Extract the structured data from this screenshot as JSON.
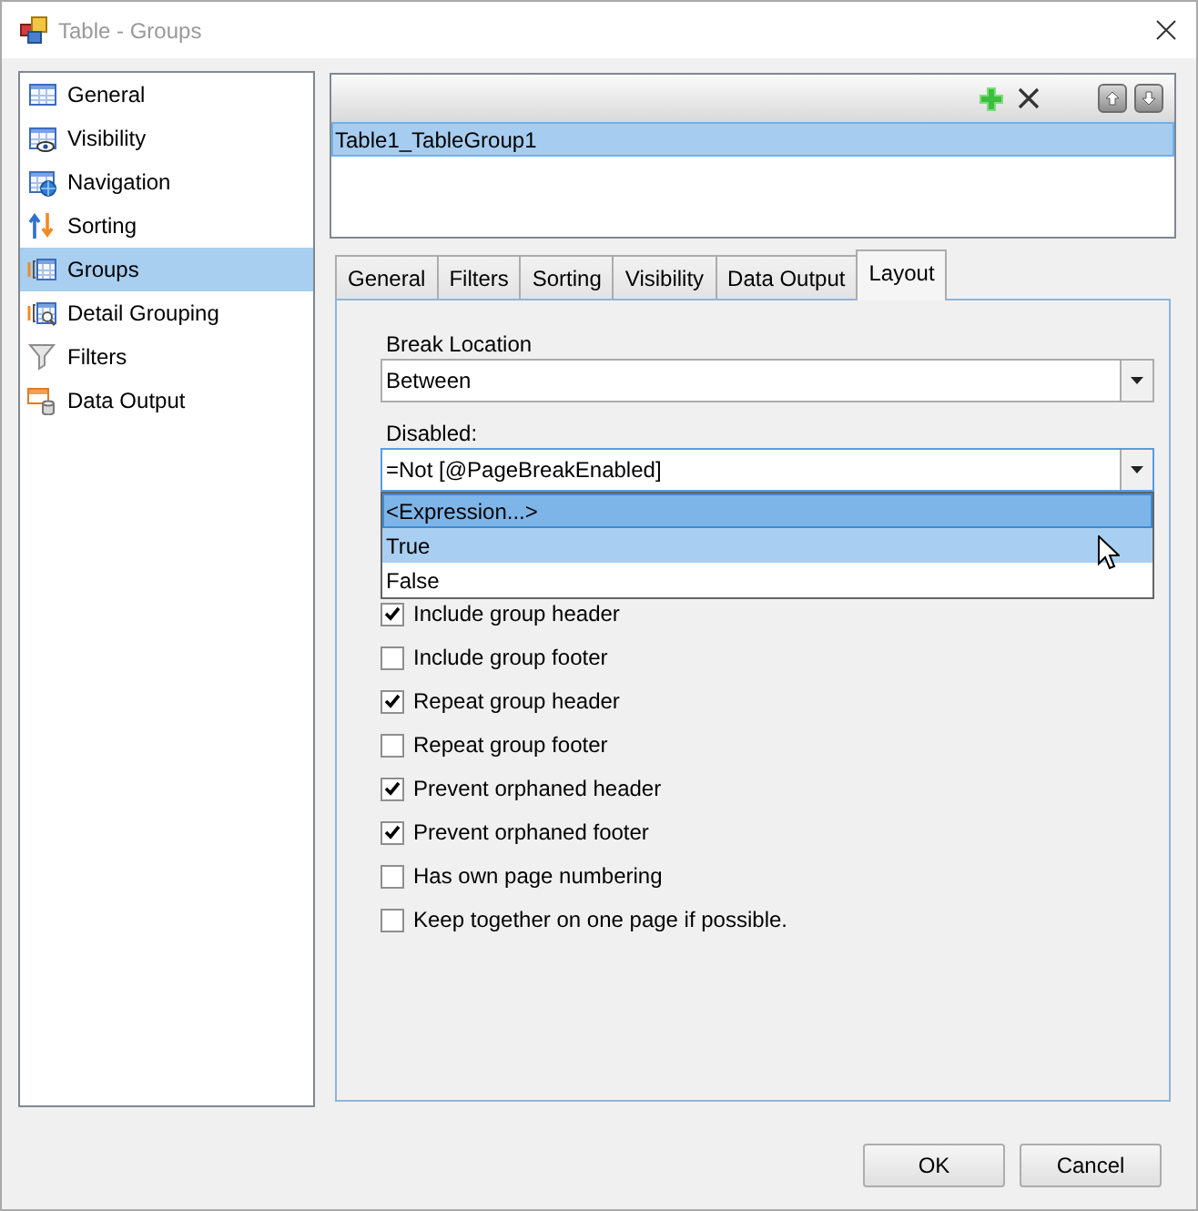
{
  "window": {
    "title": "Table - Groups"
  },
  "sidebar": {
    "items": [
      {
        "label": "General",
        "selected": false
      },
      {
        "label": "Visibility",
        "selected": false
      },
      {
        "label": "Navigation",
        "selected": false
      },
      {
        "label": "Sorting",
        "selected": false
      },
      {
        "label": "Groups",
        "selected": true
      },
      {
        "label": "Detail Grouping",
        "selected": false
      },
      {
        "label": "Filters",
        "selected": false
      },
      {
        "label": "Data Output",
        "selected": false
      }
    ]
  },
  "groups_list": {
    "rows": [
      {
        "label": "Table1_TableGroup1",
        "selected": true
      }
    ]
  },
  "tabs": [
    {
      "label": "General",
      "selected": false
    },
    {
      "label": "Filters",
      "selected": false
    },
    {
      "label": "Sorting",
      "selected": false
    },
    {
      "label": "Visibility",
      "selected": false
    },
    {
      "label": "Data Output",
      "selected": false
    },
    {
      "label": "Layout",
      "selected": true
    }
  ],
  "layout": {
    "break_location": {
      "label": "Break Location",
      "value": "Between"
    },
    "disabled": {
      "label": "Disabled:",
      "value": "=Not [@PageBreakEnabled]",
      "expanded": true,
      "options": [
        {
          "label": "<Expression...>",
          "selected": true,
          "hovered": false
        },
        {
          "label": "True",
          "selected": false,
          "hovered": true
        },
        {
          "label": "False",
          "selected": false,
          "hovered": false
        }
      ]
    },
    "checkboxes": [
      {
        "label": "Include group header",
        "checked": true
      },
      {
        "label": "Include group footer",
        "checked": false
      },
      {
        "label": "Repeat group header",
        "checked": true
      },
      {
        "label": "Repeat group footer",
        "checked": false
      },
      {
        "label": "Prevent orphaned header",
        "checked": true
      },
      {
        "label": "Prevent orphaned footer",
        "checked": true
      },
      {
        "label": "Has own page numbering",
        "checked": false
      },
      {
        "label": "Keep together on one page if possible.",
        "checked": false
      }
    ]
  },
  "buttons": [
    {
      "label": "OK"
    },
    {
      "label": "Cancel"
    }
  ]
}
